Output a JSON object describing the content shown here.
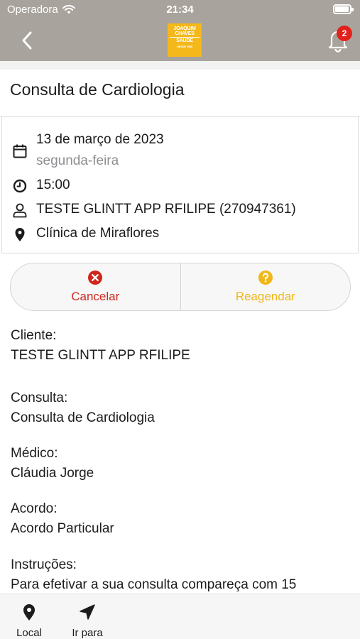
{
  "status_bar": {
    "carrier": "Operadora",
    "time": "21:34"
  },
  "header": {
    "logo_lines": [
      "JOAQUIM",
      "CHAVES",
      "SAÚDE",
      "DESDE 1985"
    ],
    "notification_count": "2"
  },
  "appointment": {
    "title": "Consulta de Cardiologia",
    "date": "13 de março de 2023",
    "weekday": "segunda-feira",
    "time": "15:00",
    "patient": "TESTE GLINTT APP RFILIPE (270947361)",
    "location": "Clínica de Miraflores"
  },
  "actions": {
    "cancel_label": "Cancelar",
    "reschedule_label": "Reagendar"
  },
  "details": {
    "client_label": "Cliente:",
    "client_value": "TESTE GLINTT APP RFILIPE",
    "consult_label": "Consulta:",
    "consult_value": "Consulta de Cardiologia",
    "doctor_label": "Médico:",
    "doctor_value": "Cláudia Jorge",
    "agreement_label": "Acordo:",
    "agreement_value": "Acordo Particular",
    "instructions_label": "Instruções:",
    "instructions_value": "Para efetivar a sua consulta compareça com 15"
  },
  "tabbar": {
    "local_label": "Local",
    "goto_label": "Ir para"
  },
  "colors": {
    "header_bg": "#a8a49d",
    "logo_bg": "#f4b81a",
    "cancel": "#d0271d",
    "reschedule": "#f0b719",
    "badge": "#e3201b"
  }
}
